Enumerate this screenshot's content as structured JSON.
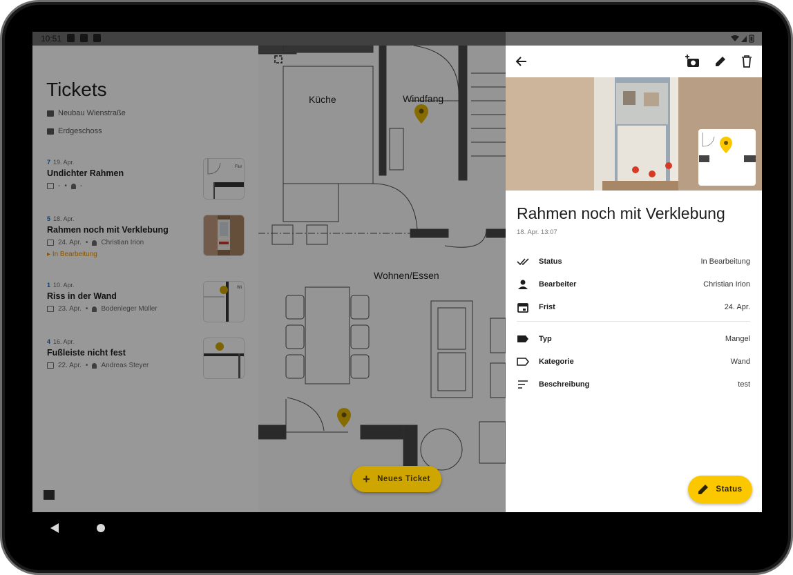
{
  "status_bar": {
    "time": "10:51"
  },
  "list": {
    "title": "Tickets",
    "project": "Neubau Wienstraße",
    "floor": "Erdgeschoss",
    "tickets": [
      {
        "num": "7",
        "date": "19. Apr.",
        "title": "Undichter Rahmen",
        "due": "-",
        "assignee": "-",
        "status": ""
      },
      {
        "num": "5",
        "date": "18. Apr.",
        "title": "Rahmen noch mit Verklebung",
        "due": "24. Apr.",
        "assignee": "Christian Irion",
        "status": "In Bearbeitung"
      },
      {
        "num": "1",
        "date": "10. Apr.",
        "title": "Riss in der Wand",
        "due": "23. Apr.",
        "assignee": "Bodenleger Müller",
        "status": ""
      },
      {
        "num": "4",
        "date": "16. Apr.",
        "title": "Fußleiste nicht fest",
        "due": "22. Apr.",
        "assignee": "Andreas Steyer",
        "status": ""
      }
    ],
    "thumb_label": "Flur",
    "thumb_label_2": "Wi"
  },
  "plan": {
    "rooms": {
      "kitchen": "Küche",
      "entry": "Windfang",
      "living": "Wohnen/Essen"
    },
    "fab_label": "Neues Ticket"
  },
  "detail": {
    "title": "Rahmen noch mit Verklebung",
    "created": "18. Apr. 13:07",
    "props": [
      {
        "label": "Status",
        "value": "In Bearbeitung"
      },
      {
        "label": "Bearbeiter",
        "value": "Christian Irion"
      },
      {
        "label": "Frist",
        "value": "24. Apr."
      },
      {
        "label": "Typ",
        "value": "Mangel"
      },
      {
        "label": "Kategorie",
        "value": "Wand"
      },
      {
        "label": "Beschreibung",
        "value": "test"
      }
    ],
    "fab_label": "Status"
  },
  "colors": {
    "accent": "#fbc800",
    "status_orange": "#e08a00",
    "link_blue": "#1565c0"
  }
}
